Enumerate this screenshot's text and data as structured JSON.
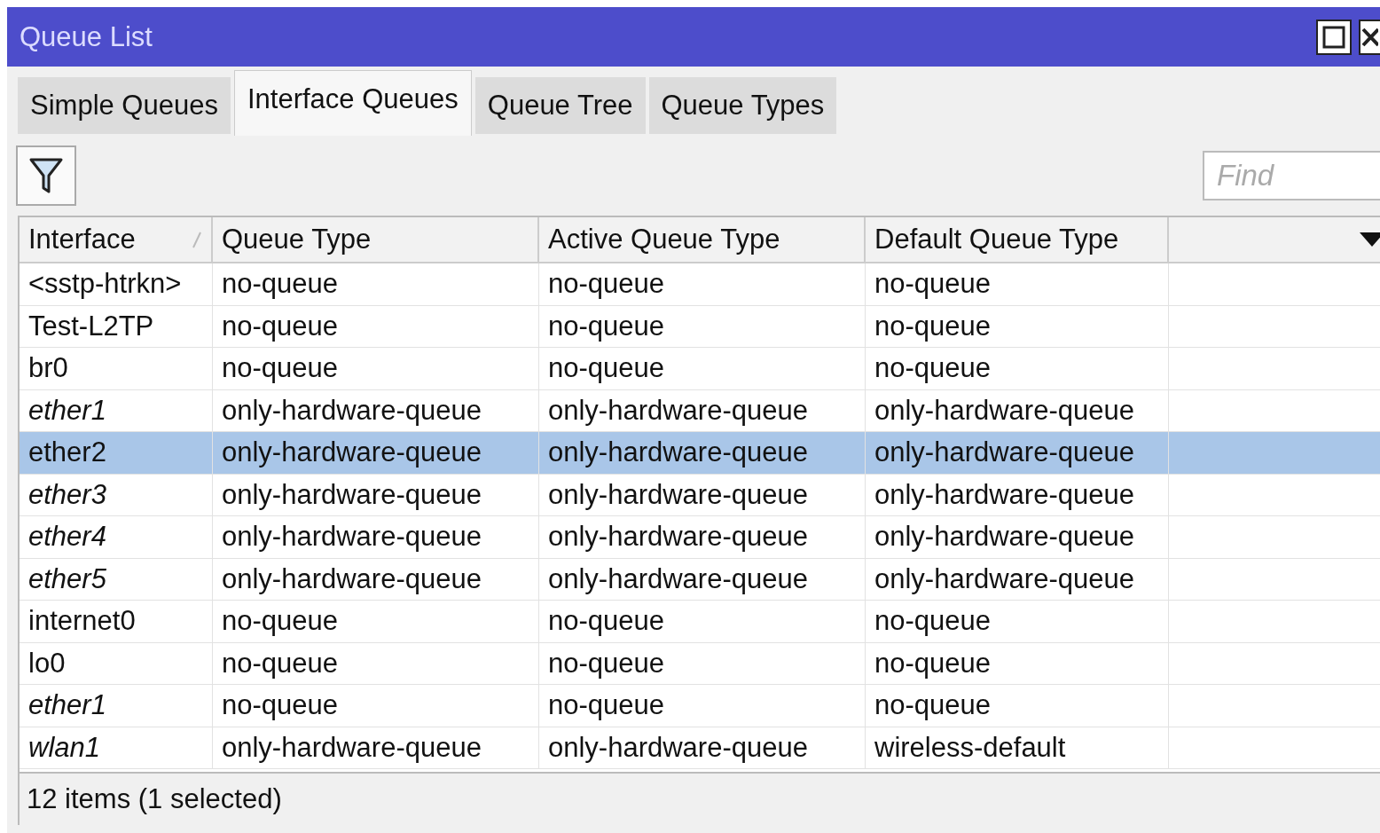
{
  "window": {
    "title": "Queue List"
  },
  "tabs": [
    {
      "label": "Simple Queues",
      "selected": false
    },
    {
      "label": "Interface Queues",
      "selected": true
    },
    {
      "label": "Queue Tree",
      "selected": false
    },
    {
      "label": "Queue Types",
      "selected": false
    }
  ],
  "search": {
    "placeholder": "Find"
  },
  "table": {
    "columns": [
      "Interface",
      "Queue Type",
      "Active Queue Type",
      "Default Queue Type"
    ],
    "rows": [
      {
        "cells": [
          "<sstp-htrkn>",
          "no-queue",
          "no-queue",
          "no-queue"
        ],
        "italic": false,
        "selected": false
      },
      {
        "cells": [
          "Test-L2TP",
          "no-queue",
          "no-queue",
          "no-queue"
        ],
        "italic": false,
        "selected": false
      },
      {
        "cells": [
          "br0",
          "no-queue",
          "no-queue",
          "no-queue"
        ],
        "italic": false,
        "selected": false
      },
      {
        "cells": [
          "ether1",
          "only-hardware-queue",
          "only-hardware-queue",
          "only-hardware-queue"
        ],
        "italic": true,
        "selected": false
      },
      {
        "cells": [
          "ether2",
          "only-hardware-queue",
          "only-hardware-queue",
          "only-hardware-queue"
        ],
        "italic": false,
        "selected": true
      },
      {
        "cells": [
          "ether3",
          "only-hardware-queue",
          "only-hardware-queue",
          "only-hardware-queue"
        ],
        "italic": true,
        "selected": false
      },
      {
        "cells": [
          "ether4",
          "only-hardware-queue",
          "only-hardware-queue",
          "only-hardware-queue"
        ],
        "italic": true,
        "selected": false
      },
      {
        "cells": [
          "ether5",
          "only-hardware-queue",
          "only-hardware-queue",
          "only-hardware-queue"
        ],
        "italic": true,
        "selected": false
      },
      {
        "cells": [
          "internet0",
          "no-queue",
          "no-queue",
          "no-queue"
        ],
        "italic": false,
        "selected": false
      },
      {
        "cells": [
          "lo0",
          "no-queue",
          "no-queue",
          "no-queue"
        ],
        "italic": false,
        "selected": false
      },
      {
        "cells": [
          "ether1",
          "no-queue",
          "no-queue",
          "no-queue"
        ],
        "italic": true,
        "selected": false
      },
      {
        "cells": [
          "wlan1",
          "only-hardware-queue",
          "only-hardware-queue",
          "wireless-default"
        ],
        "italic": true,
        "selected": false
      }
    ]
  },
  "status_bar": "12 items (1 selected)"
}
